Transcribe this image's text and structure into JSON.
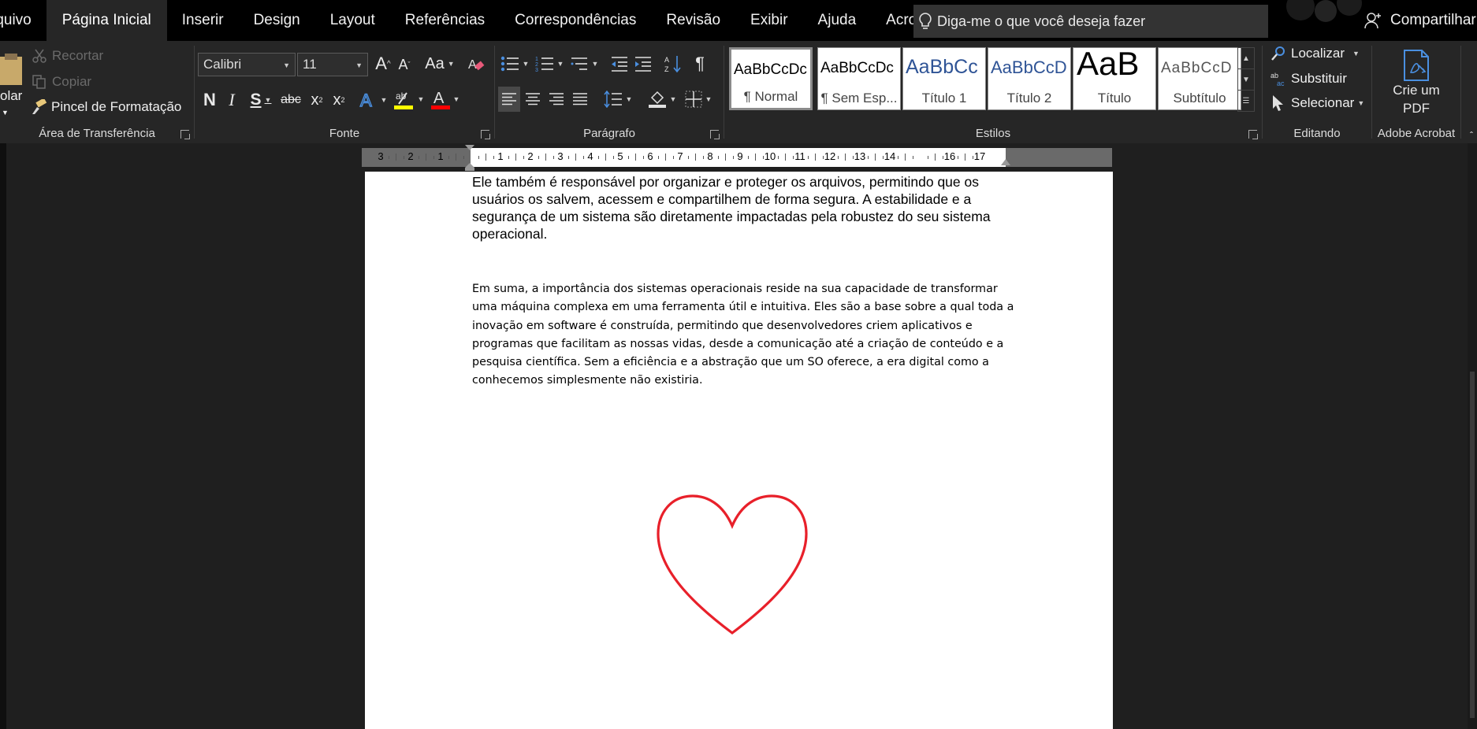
{
  "menu": {
    "tabs": [
      "rquivo",
      "Página Inicial",
      "Inserir",
      "Design",
      "Layout",
      "Referências",
      "Correspondências",
      "Revisão",
      "Exibir",
      "Ajuda",
      "Acrobat"
    ],
    "active_tab": "Página Inicial",
    "tell_me_placeholder": "Diga-me o que você deseja fazer",
    "share_label": "Compartilhar"
  },
  "clipboard": {
    "paste_label": "olar",
    "cut_label": "Recortar",
    "copy_label": "Copiar",
    "format_painter_label": "Pincel de Formatação",
    "group_label": "Área de Transferência"
  },
  "font": {
    "font_name": "Calibri",
    "font_size": "11",
    "bold": "N",
    "italic": "I",
    "underline": "S",
    "strikethrough": "abc",
    "subscript": "x",
    "superscript": "x",
    "case_label": "Aa",
    "highlight_color": "#ffff00",
    "font_color": "#ff0000",
    "group_label": "Fonte"
  },
  "paragraph": {
    "group_label": "Parágrafo"
  },
  "styles": {
    "items": [
      {
        "sample": "AaBbCcDc",
        "name": "¶ Normal"
      },
      {
        "sample": "AaBbCcDc",
        "name": "¶ Sem Esp..."
      },
      {
        "sample": "AaBbCc",
        "name": "Título 1"
      },
      {
        "sample": "AaBbCcD",
        "name": "Título 2"
      },
      {
        "sample": "AaB",
        "name": "Título"
      },
      {
        "sample": "AaBbCcD",
        "name": "Subtítulo"
      }
    ],
    "group_label": "Estilos"
  },
  "editing": {
    "find_label": "Localizar",
    "replace_label": "Substituir",
    "select_label": "Selecionar",
    "group_label": "Editando"
  },
  "acrobat": {
    "create_pdf_line1": "Crie um",
    "create_pdf_line2": "PDF",
    "group_label": "Adobe Acrobat"
  },
  "ruler": {
    "labels": [
      "3",
      "2",
      "1",
      "1",
      "2",
      "3",
      "4",
      "5",
      "6",
      "7",
      "8",
      "9",
      "10",
      "11",
      "12",
      "13",
      "14",
      "16",
      "17"
    ]
  },
  "document": {
    "paragraph1": "Ele também é responsável por organizar e proteger os arquivos, permitindo que os usuários os salvem, acessem e compartilhem de forma segura. A estabilidade e a segurança de um sistema são diretamente impactadas pela robustez do seu sistema operacional.",
    "paragraph2": "Em suma, a importância dos sistemas operacionais reside na sua capacidade de transformar uma máquina complexa em uma ferramenta útil e intuitiva. Eles são a base sobre a qual toda a inovação em software é construída, permitindo que desenvolvedores criem aplicativos e programas que facilitam as nossas vidas, desde a comunicação até a criação de conteúdo e a pesquisa científica. Sem a eficiência e a abstração que um SO oferece, a era digital como a conhecemos simplesmente não existiria.",
    "shape": "heart-outline",
    "shape_color": "#e8202a"
  }
}
